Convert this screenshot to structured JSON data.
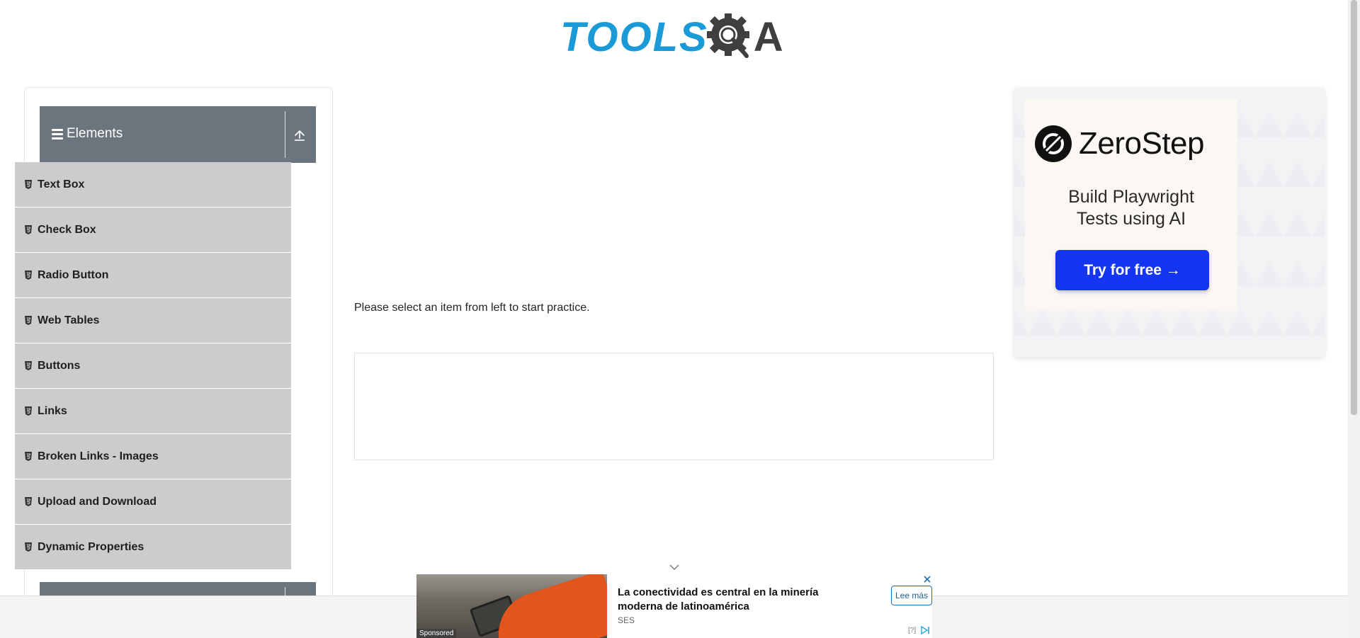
{
  "header": {
    "logo_text_left": "TOOLS",
    "logo_text_right": "A",
    "logo_color_primary": "#1a9bd7",
    "logo_color_secondary": "#3f3f3f"
  },
  "sidebar": {
    "group_title": "Elements",
    "group_icon": "hamburger-icon",
    "toggle_icon": "arrow-up-icon",
    "header_color": "#6c757d",
    "item_color": "#cccccc",
    "items": [
      {
        "label": "Text Box"
      },
      {
        "label": "Check Box"
      },
      {
        "label": "Radio Button"
      },
      {
        "label": "Web Tables"
      },
      {
        "label": "Buttons"
      },
      {
        "label": "Links"
      },
      {
        "label": "Broken Links - Images"
      },
      {
        "label": "Upload and Download"
      },
      {
        "label": "Dynamic Properties"
      }
    ]
  },
  "main": {
    "prompt": "Please select an item from left to start practice."
  },
  "side_ad": {
    "brand": "ZeroStep",
    "headline_line1": "Build Playwright",
    "headline_line2": "Tests using AI",
    "cta": "Try for free →",
    "cta_color": "#1436f0"
  },
  "bottom_ad": {
    "title": "La conectividad es central en la minería moderna de latinoamérica",
    "source": "SES",
    "more_label": "Lee más",
    "sponsored_label": "Sponsored",
    "help_label": "[?]"
  }
}
